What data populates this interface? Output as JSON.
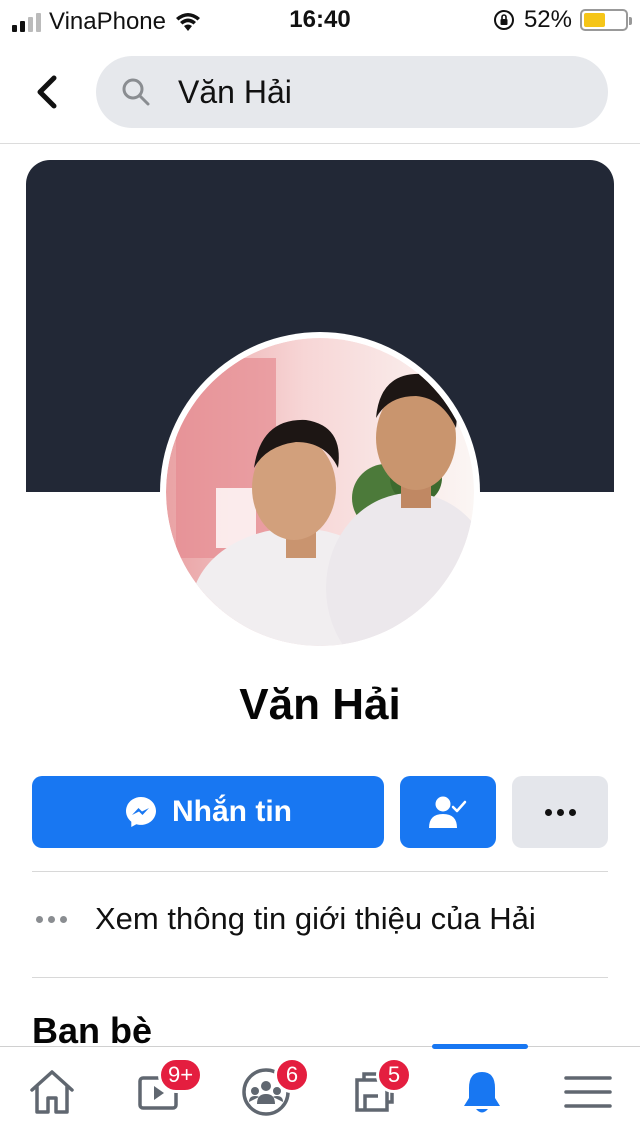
{
  "status_bar": {
    "carrier": "VinaPhone",
    "time": "16:40",
    "battery_percent": "52%",
    "battery_level": 0.52,
    "icons": [
      "signal-icon",
      "wifi-icon",
      "rotation-lock-icon",
      "battery-icon"
    ]
  },
  "search": {
    "query": "Văn Hải",
    "icon": "search-icon"
  },
  "profile": {
    "name": "Văn Hải",
    "cover_color": "#222836"
  },
  "actions": {
    "message_label": "Nhắn tin",
    "friends_icon": "friends-check-icon",
    "more_icon": "more-dots-icon",
    "accent": "#1877f2"
  },
  "about": {
    "label": "Xem thông tin giới thiệu của Hải"
  },
  "friends_section": {
    "title": "Ban bè"
  },
  "tabs": [
    {
      "name": "home",
      "icon": "home-icon",
      "badge": ""
    },
    {
      "name": "watch",
      "icon": "video-icon",
      "badge": "9+"
    },
    {
      "name": "groups",
      "icon": "groups-icon",
      "badge": "6"
    },
    {
      "name": "pages",
      "icon": "pages-icon",
      "badge": "5"
    },
    {
      "name": "notifications",
      "icon": "bell-icon",
      "badge": "",
      "active": true
    },
    {
      "name": "menu",
      "icon": "menu-icon",
      "badge": ""
    }
  ]
}
